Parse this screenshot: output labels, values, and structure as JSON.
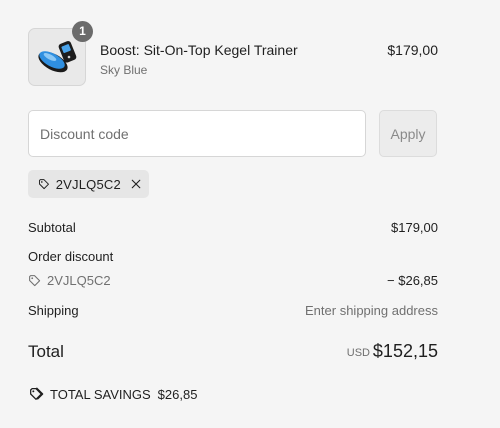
{
  "product": {
    "quantity": "1",
    "name": "Boost: Sit-On-Top Kegel Trainer",
    "variant": "Sky Blue",
    "price": "$179,00"
  },
  "discount": {
    "placeholder": "Discount code",
    "apply_label": "Apply",
    "applied_code": "2VJLQ5C2"
  },
  "summary": {
    "subtotal_label": "Subtotal",
    "subtotal_value": "$179,00",
    "order_discount_label": "Order discount",
    "order_discount_code": "2VJLQ5C2",
    "order_discount_value": "− $26,85",
    "shipping_label": "Shipping",
    "shipping_value": "Enter shipping address",
    "total_label": "Total",
    "total_currency": "USD",
    "total_value": "$152,15",
    "savings_label": "TOTAL SAVINGS",
    "savings_value": "$26,85"
  },
  "icons": {
    "product_image": "kegel-trainer-product-image",
    "tag": "tag-icon",
    "remove": "close-icon",
    "savings": "double-tag-icon"
  },
  "colors": {
    "background": "#f5f5f5",
    "badge": "#6b6b6b",
    "product_blue": "#2f8fe0"
  }
}
